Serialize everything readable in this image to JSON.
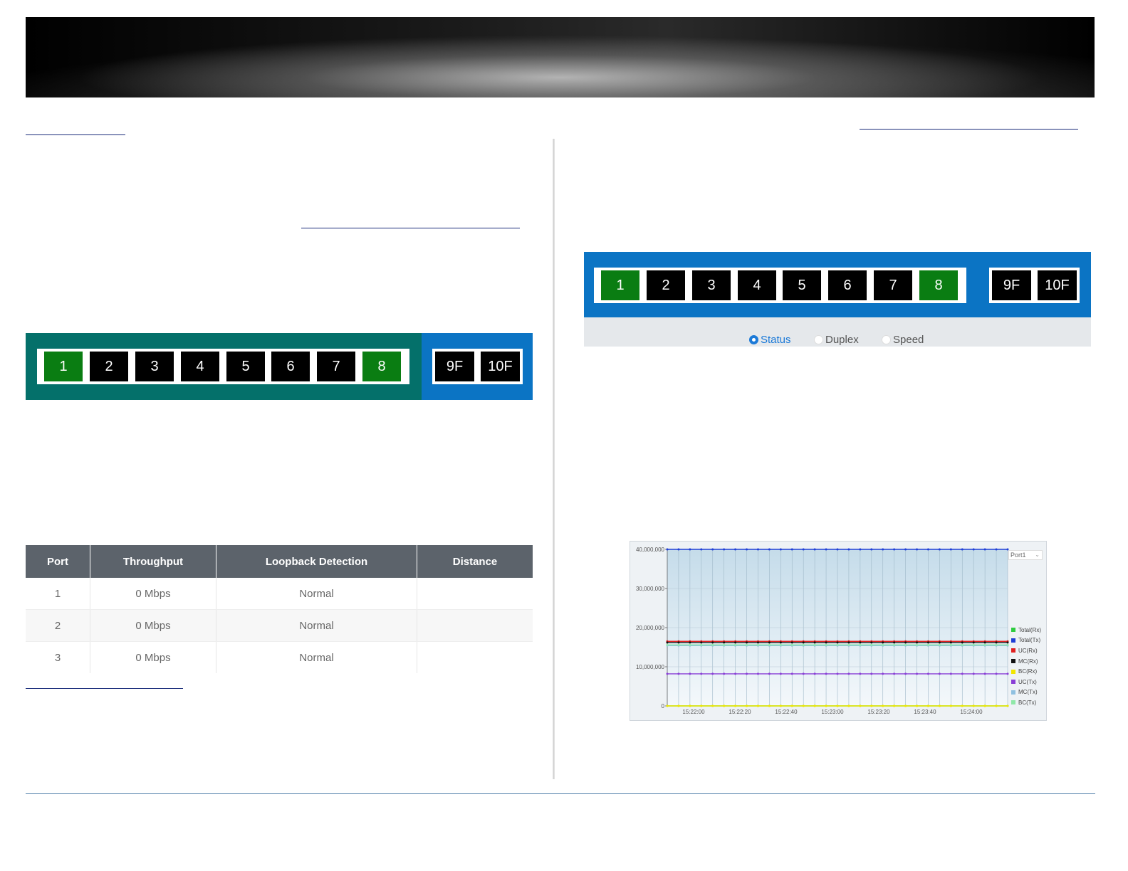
{
  "left_panel": {
    "ports": [
      {
        "label": "1",
        "state": "up"
      },
      {
        "label": "2",
        "state": "down"
      },
      {
        "label": "3",
        "state": "down"
      },
      {
        "label": "4",
        "state": "down"
      },
      {
        "label": "5",
        "state": "down"
      },
      {
        "label": "6",
        "state": "down"
      },
      {
        "label": "7",
        "state": "down"
      },
      {
        "label": "8",
        "state": "up"
      }
    ],
    "fiber_ports": [
      "9F",
      "10F"
    ],
    "copper_bg": "#04706a",
    "fiber_bg": "#0b74c4"
  },
  "right_panel": {
    "ports": [
      {
        "label": "1",
        "state": "up"
      },
      {
        "label": "2",
        "state": "down"
      },
      {
        "label": "3",
        "state": "down"
      },
      {
        "label": "4",
        "state": "down"
      },
      {
        "label": "5",
        "state": "down"
      },
      {
        "label": "6",
        "state": "down"
      },
      {
        "label": "7",
        "state": "down"
      },
      {
        "label": "8",
        "state": "up"
      }
    ],
    "fiber_ports": [
      "9F",
      "10F"
    ],
    "bg": "#0b74c4",
    "view_options": [
      {
        "label": "Status",
        "selected": true
      },
      {
        "label": "Duplex",
        "selected": false
      },
      {
        "label": "Speed",
        "selected": false
      }
    ]
  },
  "port_table": {
    "headers": [
      "Port",
      "Throughput",
      "Loopback Detection",
      "Distance"
    ],
    "rows": [
      [
        "1",
        "0 Mbps",
        "Normal",
        ""
      ],
      [
        "2",
        "0 Mbps",
        "Normal",
        ""
      ],
      [
        "3",
        "0 Mbps",
        "Normal",
        ""
      ]
    ]
  },
  "chart_data": {
    "type": "line",
    "title": "",
    "xlabel": "",
    "ylabel": "",
    "port_selector": "Port1",
    "x_tick_labels": [
      "15:22:00",
      "15:22:20",
      "15:22:40",
      "15:23:00",
      "15:23:20",
      "15:23:40",
      "15:24:00"
    ],
    "y_tick_labels": [
      "40,000,000",
      "30,000,000",
      "20,000,000",
      "10,000,000",
      "0"
    ],
    "ylim": [
      0,
      40000000
    ],
    "grid": true,
    "legend_position": "right",
    "series": [
      {
        "name": "Total(Rx)",
        "color": "#2ecc40",
        "value": 0
      },
      {
        "name": "Total(Tx)",
        "color": "#1f3fd6",
        "value": 40000000
      },
      {
        "name": "UC(Rx)",
        "color": "#e02020",
        "value": 16500000
      },
      {
        "name": "MC(Rx)",
        "color": "#111111",
        "value": 16200000
      },
      {
        "name": "BC(Rx)",
        "color": "#f2e600",
        "value": 0
      },
      {
        "name": "UC(Tx)",
        "color": "#8a3fd6",
        "value": 8200000
      },
      {
        "name": "MC(Tx)",
        "color": "#8fc0e0",
        "value": 15400000
      },
      {
        "name": "BC(Tx)",
        "color": "#8fe8a8",
        "value": 15600000
      }
    ]
  }
}
